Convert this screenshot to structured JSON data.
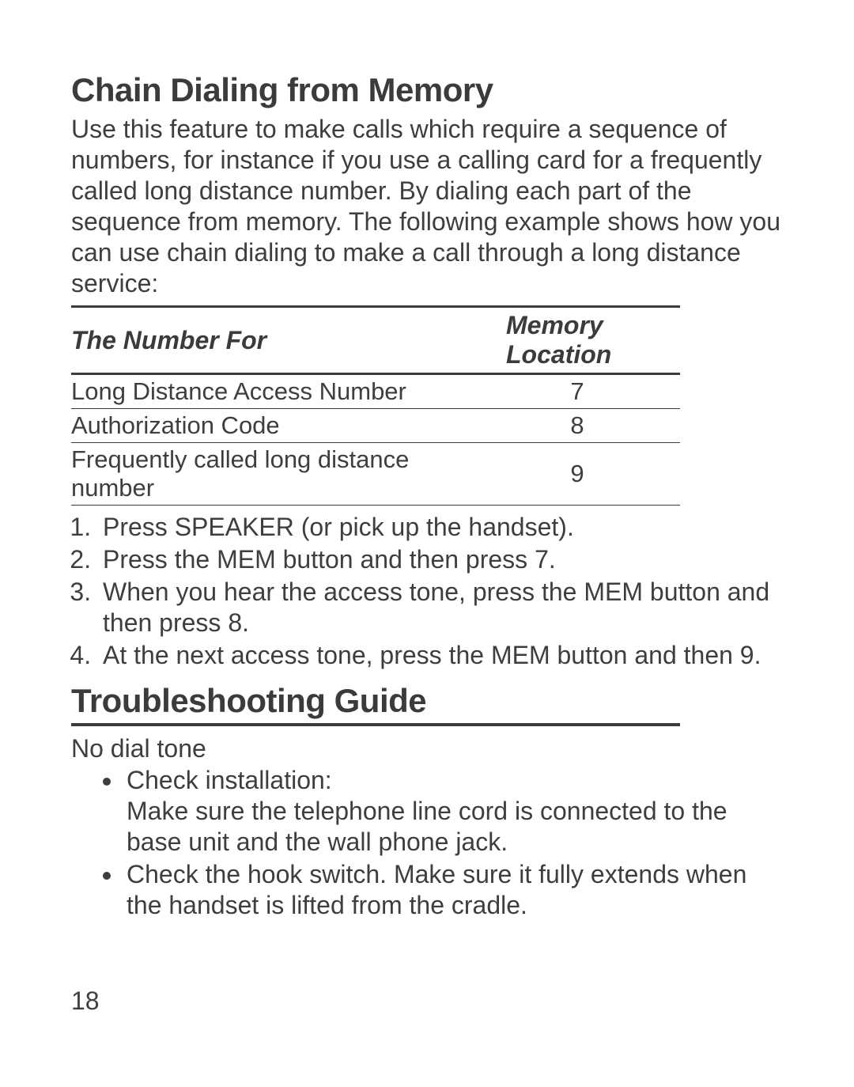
{
  "section1": {
    "title": "Chain Dialing from Memory",
    "intro": "Use this feature to make calls which require a sequence of numbers, for instance if you use a calling card for a frequently called long distance number. By dialing each part of the sequence from memory. The following example shows how you can use chain dialing to make a call through a long distance service:",
    "table": {
      "headers": {
        "left": "The Number For",
        "right": "Memory Location"
      },
      "rows": [
        {
          "label": "Long Distance Access Number",
          "loc": "7"
        },
        {
          "label": "Authorization Code",
          "loc": "8"
        },
        {
          "label": "Frequently called long distance number",
          "loc": "9"
        }
      ]
    },
    "steps": [
      "Press SPEAKER (or pick up the handset).",
      "Press the MEM button and then press 7.",
      "When you hear the access tone, press the MEM button and then press 8.",
      "At the next access tone, press the MEM button and then 9."
    ]
  },
  "section2": {
    "title": "Troubleshooting Guide",
    "sub": "No dial tone",
    "bullets": [
      {
        "lead": "Check installation:",
        "body": "Make sure the telephone line cord is connected to the base unit and the wall phone jack."
      },
      {
        "lead": "Check the hook switch. Make sure it fully extends when the handset is lifted from the cradle.",
        "body": ""
      }
    ]
  },
  "page_number": "18"
}
